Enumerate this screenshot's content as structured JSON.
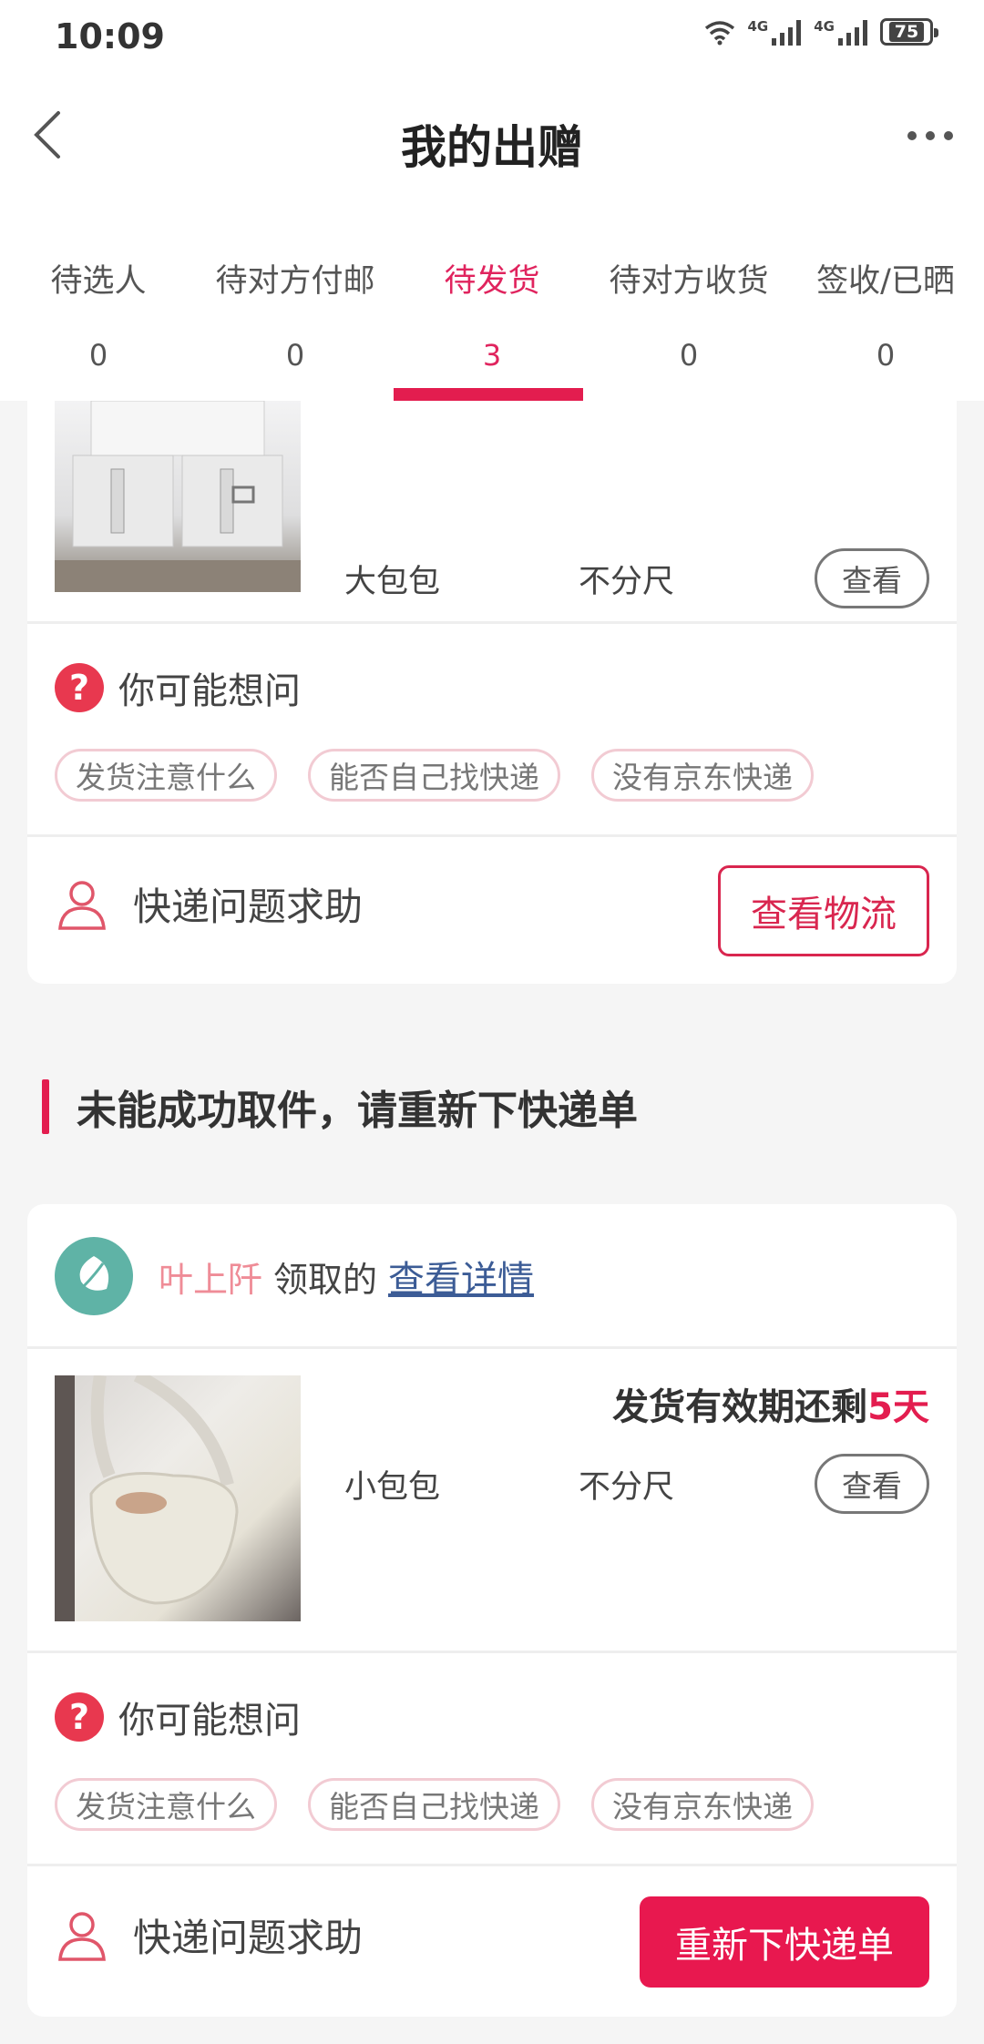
{
  "status_bar": {
    "time": "10:09",
    "battery": "75",
    "network_1": "4G",
    "network_2": "4G"
  },
  "nav": {
    "title": "我的出赠",
    "back_icon": "chevron-left-icon",
    "more_icon": "more-horizontal-icon"
  },
  "tabs": [
    {
      "label": "待选人",
      "count": "0",
      "active": false
    },
    {
      "label": "待对方付邮",
      "count": "0",
      "active": false
    },
    {
      "label": "待发货",
      "count": "3",
      "active": true
    },
    {
      "label": "待对方收货",
      "count": "0",
      "active": false
    },
    {
      "label": "签收/已晒",
      "count": "0",
      "active": false
    }
  ],
  "colors": {
    "accent": "#e31d4f",
    "link": "#3c5c96",
    "claimer": "#ef8c97"
  },
  "order1": {
    "product_name": "大包包",
    "size": "不分尺",
    "view_label": "查看",
    "ask_label": "你可能想问",
    "chips": [
      "发货注意什么",
      "能否自己找快递",
      "没有京东快递"
    ],
    "help_label": "快递问题求助",
    "action_label": "查看物流"
  },
  "section_title": "未能成功取件，请重新下快递单",
  "order2": {
    "claimer": "叶上阡",
    "claim_text": "领取的",
    "detail_link": "查看详情",
    "deadline_prefix": "发货有效期还剩",
    "deadline_value": "5天",
    "product_name": "小包包",
    "size": "不分尺",
    "view_label": "查看",
    "ask_label": "你可能想问",
    "chips": [
      "发货注意什么",
      "能否自己找快递",
      "没有京东快递"
    ],
    "help_label": "快递问题求助",
    "action_label": "重新下快递单"
  }
}
